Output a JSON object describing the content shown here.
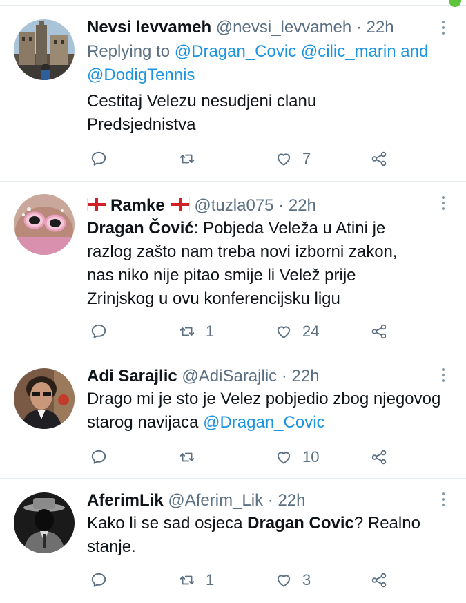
{
  "colors": {
    "link": "#1b95e0",
    "text": "#0f1419",
    "muted": "#5b7083",
    "divider": "#e6ecf0",
    "status_dot": "#5fc33b"
  },
  "icons": {
    "reply": "reply-icon",
    "retweet": "retweet-icon",
    "like": "heart-icon",
    "share": "share-icon",
    "more": "more-vertical-icon",
    "flag": "england-flag-icon"
  },
  "tweets": [
    {
      "name": "Nevsi levvameh",
      "handle": "@nevsi_levvameh",
      "separator": "·",
      "time": "22h",
      "reply_prefix": "Replying to",
      "reply_to": "@Dragan_Covic @cilic_marin",
      "reply_and": "and",
      "reply_last": "@DodigTennis",
      "text": "Cestitaj Velezu nesudjeni clanu Predsjednistva",
      "retweets": "",
      "likes": "7"
    },
    {
      "name": "Ramke",
      "handle": "@tuzla075",
      "separator": "·",
      "time": "22h",
      "text_bold": "Dragan Čović",
      "text_rest": ": Pobjeda Veleža u Atini je razlog zašto nam treba novi izborni zakon, nas niko nije pitao smije li Velež prije Zrinjskog u ovu konferencijsku ligu",
      "retweets": "1",
      "likes": "24"
    },
    {
      "name": "Adi Sarajlic",
      "handle": "@AdiSarajlic",
      "separator": "·",
      "time": "22h",
      "text": "Drago mi je sto je Velez pobjedio zbog njegovog starog navijaca ",
      "text_mention": "@Dragan_Covic",
      "retweets": "",
      "likes": "10"
    },
    {
      "name": "AferimLik",
      "handle": "@Aferim_Lik",
      "separator": "·",
      "time": "22h",
      "text_start": "Kako li se sad osjeca ",
      "text_bold": "Dragan Covic",
      "text_end": "? Realno stanje.",
      "retweets": "1",
      "likes": "3"
    }
  ]
}
